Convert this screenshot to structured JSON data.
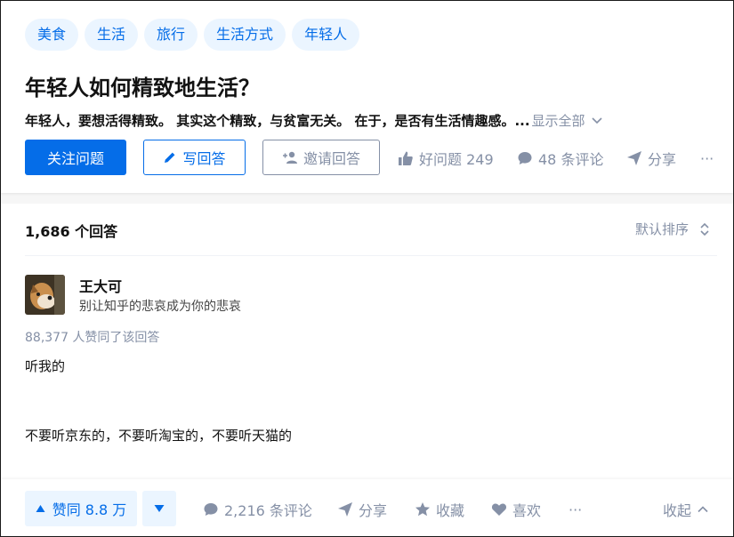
{
  "question": {
    "tags": [
      "美食",
      "生活",
      "旅行",
      "生活方式",
      "年轻人"
    ],
    "title": "年轻人如何精致地生活？",
    "excerpt": "年轻人，要想活得精致。 其实这个精致，与贫富无关。 在于，是否有生活情趣感。...",
    "show_all": "显示全部",
    "buttons": {
      "follow": "关注问题",
      "write": "写回答",
      "invite": "邀请回答"
    },
    "good_question": "好问题 249",
    "comments": "48 条评论",
    "share": "分享",
    "more_icon": "···"
  },
  "answers": {
    "count_label": "1,686 个回答",
    "sort_label": "默认排序"
  },
  "answer": {
    "author": "王大可",
    "bio": "别让知乎的悲哀成为你的悲哀",
    "vote_text": "88,377 人赞同了该回答",
    "content": [
      "听我的",
      "不要听京东的，不要听淘宝的，不要听天猫的"
    ]
  },
  "actions": {
    "vote_up": "赞同 8.8 万",
    "comments": "2,216 条评论",
    "share": "分享",
    "collect": "收藏",
    "like": "喜欢",
    "more_icon": "···",
    "collapse": "收起"
  },
  "colors": {
    "accent": "#056de8",
    "tag_bg": "#ebf5ff",
    "muted": "#8590a6"
  }
}
